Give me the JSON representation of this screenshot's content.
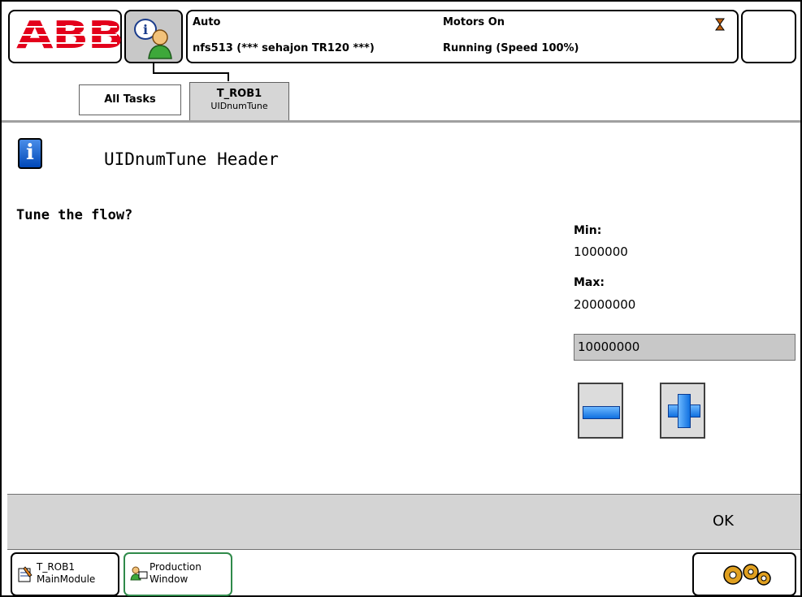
{
  "topbar": {
    "logo_text": "ABB",
    "mode": "Auto",
    "system_name": "nfs513 (*** sehajon TR120 ***)",
    "motors": "Motors On",
    "run_state": "Running (Speed 100%)"
  },
  "tabs": [
    {
      "label": "All Tasks"
    },
    {
      "label": "T_ROB1",
      "sublabel": "UIDnumTune"
    }
  ],
  "dialog": {
    "header": "UIDnumTune Header",
    "message": "Tune the flow?",
    "min_label": "Min:",
    "min_value": "1000000",
    "max_label": "Max:",
    "max_value": "20000000",
    "current_value": "10000000",
    "ok_label": "OK"
  },
  "taskbar": [
    {
      "line1": "T_ROB1",
      "line2": "MainModule"
    },
    {
      "line1": "Production",
      "line2": "Window"
    }
  ],
  "colors": {
    "abb_red": "#e3001b",
    "info_blue": "#0048b8"
  }
}
